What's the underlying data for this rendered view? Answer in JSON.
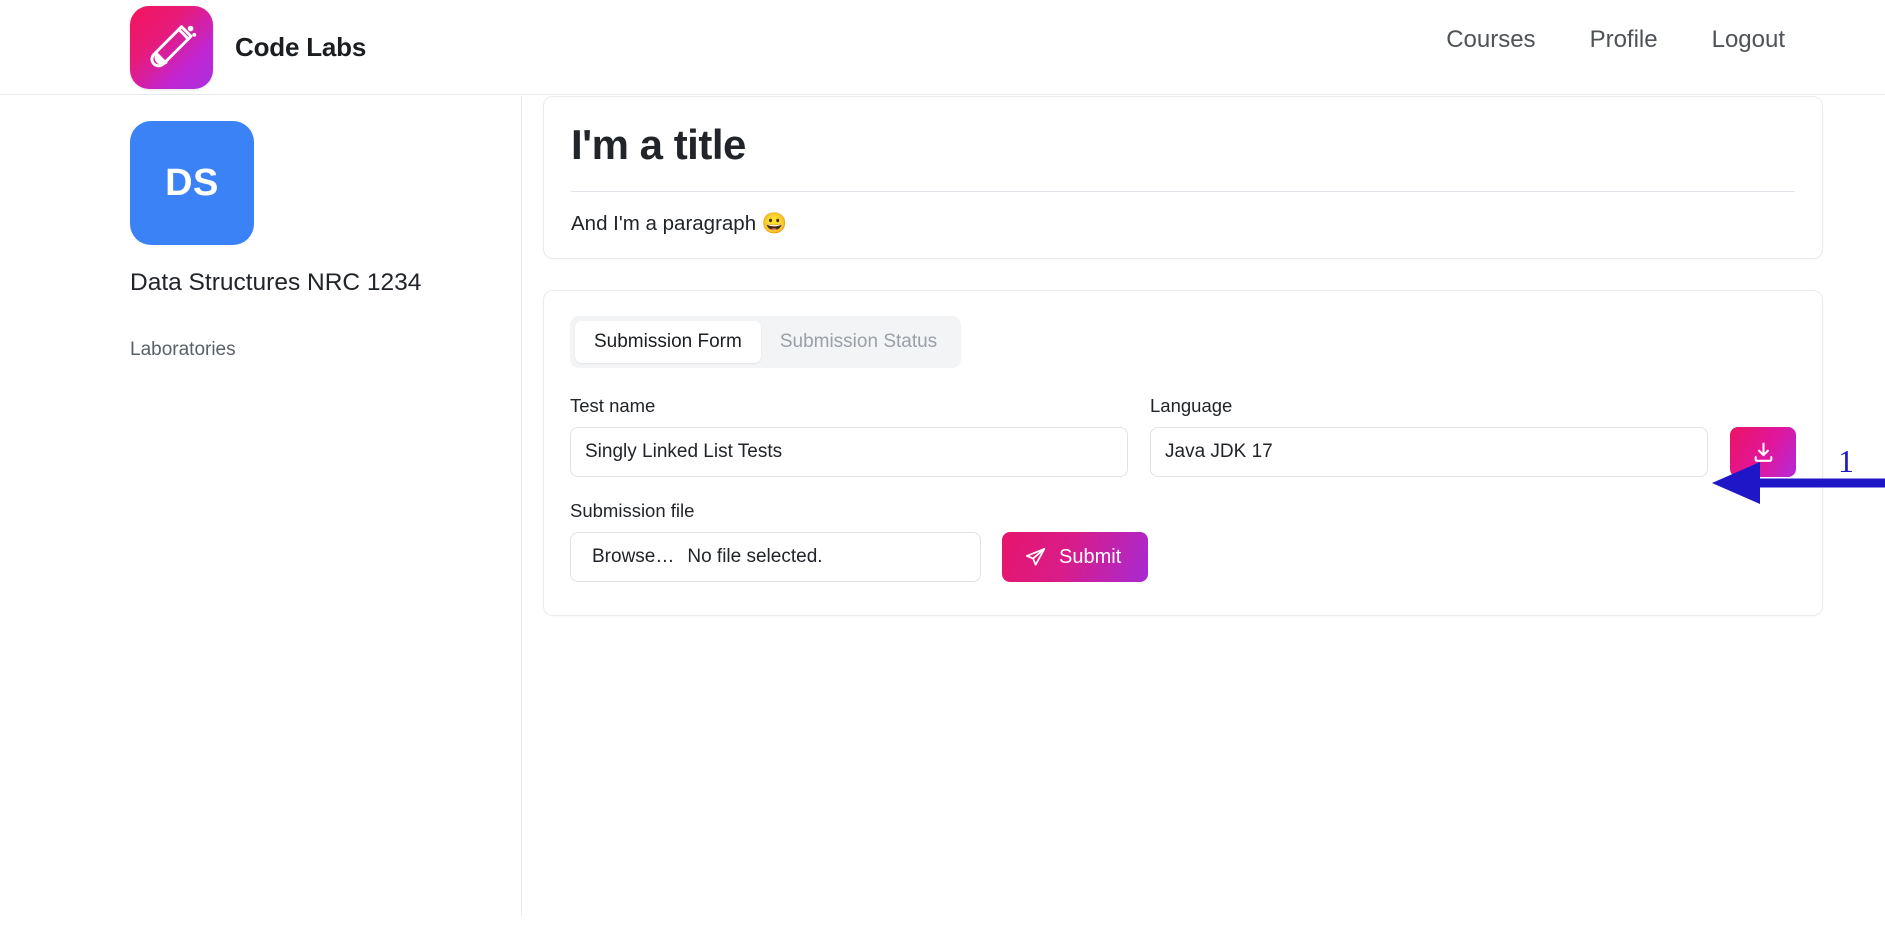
{
  "header": {
    "brand_name": "Code Labs",
    "logo_icon": "test-tube-icon",
    "nav": [
      {
        "label": "Courses",
        "name": "courses"
      },
      {
        "label": "Profile",
        "name": "profile"
      },
      {
        "label": "Logout",
        "name": "logout"
      }
    ]
  },
  "sidebar": {
    "course_initials": "DS",
    "course_title": "Data Structures NRC 1234",
    "links": [
      {
        "label": "Laboratories",
        "name": "laboratories"
      }
    ]
  },
  "main": {
    "intro": {
      "title": "I'm a title",
      "paragraph": "And I'm a paragraph 😀"
    },
    "tabs": [
      {
        "label": "Submission Form",
        "active": true
      },
      {
        "label": "Submission Status",
        "active": false
      }
    ],
    "form": {
      "test_name_label": "Test name",
      "test_name_value": "Singly Linked List Tests",
      "test_name_placeholder": "Test name",
      "language_label": "Language",
      "language_value": "Java JDK 17",
      "language_placeholder": "Language",
      "download_icon": "download-icon",
      "submission_file_label": "Submission file",
      "browse_button_label": "Browse…",
      "file_status_text": "No file selected.",
      "submit_label": "Submit",
      "submit_icon": "paper-plane-icon"
    }
  },
  "annotation": {
    "number": "1",
    "color": "#1f16c8"
  },
  "colors": {
    "brand_gradient_start": "#ec1265",
    "brand_gradient_end": "#b32ad8",
    "course_tile": "#3b82f6",
    "annotation_blue": "#1f16c8",
    "border": "#e9ecef"
  }
}
